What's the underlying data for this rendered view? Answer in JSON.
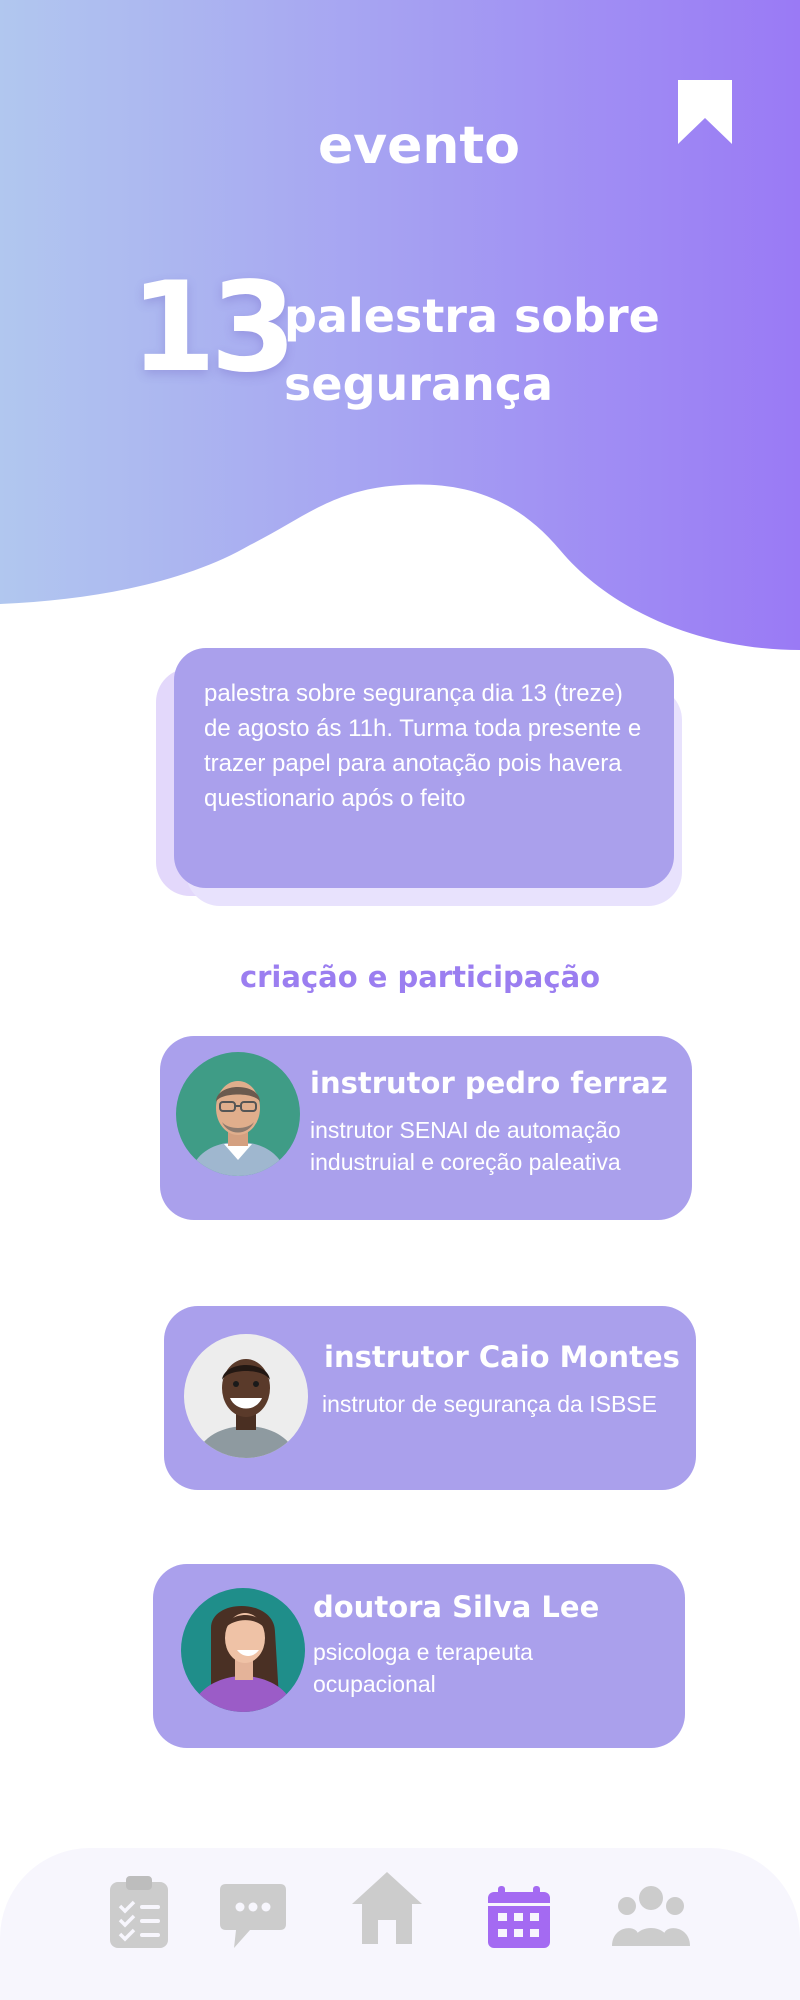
{
  "header": {
    "title": "evento",
    "event_day": "13",
    "event_name": "palestra sobre segurança"
  },
  "description": "palestra sobre segurança dia 13 (treze) de agosto ás 11h. Turma toda presente e trazer papel para anotação pois havera questionario após o feito",
  "section_title": "criação e participação",
  "participants": [
    {
      "name": "instrutor pedro ferraz",
      "role": "instrutor SENAI de automação industruial e coreção paleativa"
    },
    {
      "name": "instrutor Caio Montes",
      "role": "instrutor de segurança da ISBSE"
    },
    {
      "name": "doutora Silva Lee",
      "role": "psicologa e terapeuta ocupacional"
    }
  ],
  "nav": {
    "items": [
      {
        "icon": "clipboard-list-icon",
        "active": false
      },
      {
        "icon": "chat-bubble-icon",
        "active": false
      },
      {
        "icon": "home-icon",
        "active": false
      },
      {
        "icon": "calendar-icon",
        "active": true
      },
      {
        "icon": "users-icon",
        "active": false
      }
    ]
  },
  "colors": {
    "gradient_start": "#b1c7ef",
    "gradient_end": "#9a7af5",
    "card": "#aaa0ec",
    "accent_text": "#9b7ef0",
    "nav_active": "#a46af2",
    "nav_inactive": "#cccccc"
  }
}
